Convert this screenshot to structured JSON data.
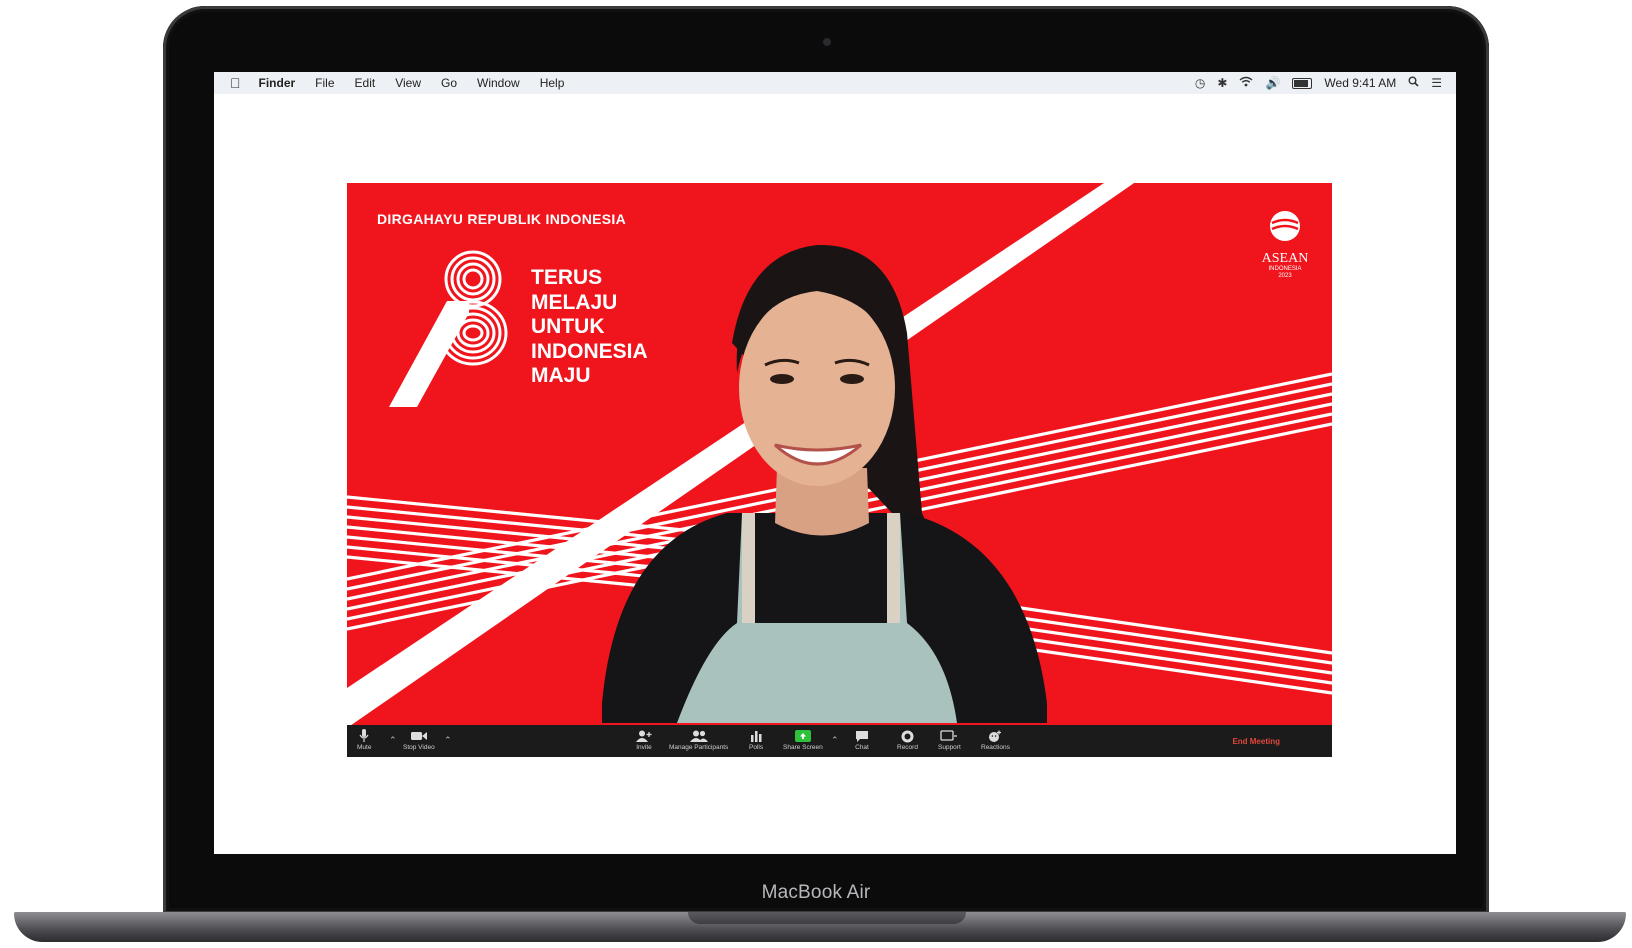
{
  "device": {
    "label": "MacBook Air"
  },
  "menubar": {
    "app_name": "Finder",
    "items": [
      "File",
      "Edit",
      "View",
      "Go",
      "Window",
      "Help"
    ],
    "clock": "Wed 9:41 AM",
    "tray_icons": [
      "time-machine-icon",
      "bluetooth-icon",
      "wifi-icon",
      "volume-icon",
      "battery-icon",
      "spotlight-icon",
      "control-center-icon"
    ]
  },
  "meeting": {
    "background": {
      "title": "DIRGAHAYU REPUBLIK INDONESIA",
      "anniversary_number": "78",
      "slogan_lines": [
        "TERUS",
        "MELAJU",
        "UNTUK",
        "INDONESIA",
        "MAJU"
      ],
      "badge": {
        "name": "ASEAN",
        "sub1": "INDONESIA",
        "sub2": "2023"
      },
      "colors": {
        "red": "#f0141c",
        "stripe": "#ffffff"
      }
    },
    "participant": "smiling-woman-video"
  },
  "toolbar": {
    "mute": "Mute",
    "stop_video": "Stop Video",
    "invite": "Invite",
    "manage_participants": "Manage Participants",
    "polls": "Polls",
    "share_screen": "Share Screen",
    "chat": "Chat",
    "record": "Record",
    "support": "Support",
    "reactions": "Reactions",
    "end_meeting": "End Meeting"
  }
}
